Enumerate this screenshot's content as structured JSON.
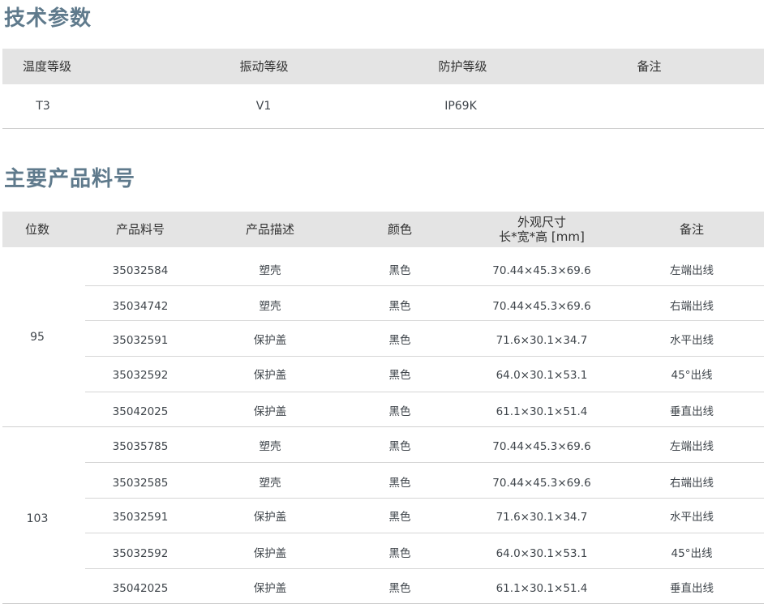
{
  "tech": {
    "title": "技术参数",
    "headers": [
      "温度等级",
      "振动等级",
      "防护等级",
      "备注"
    ],
    "values": [
      "T3",
      "V1",
      "IP69K",
      ""
    ]
  },
  "products": {
    "title": "主要产品料号",
    "headers": {
      "digits": "位数",
      "part_no": "产品料号",
      "desc": "产品描述",
      "color": "颜色",
      "dims_line1": "外观尺寸",
      "dims_line2": "长*宽*高 [mm]",
      "note": "备注"
    },
    "groups": [
      {
        "digits": "95",
        "rows": [
          [
            "35032584",
            "塑壳",
            "黑色",
            "70.44×45.3×69.6",
            "左端出线"
          ],
          [
            "35034742",
            "塑壳",
            "黑色",
            "70.44×45.3×69.6",
            "右端出线"
          ],
          [
            "35032591",
            "保护盖",
            "黑色",
            "71.6×30.1×34.7",
            "水平出线"
          ],
          [
            "35032592",
            "保护盖",
            "黑色",
            "64.0×30.1×53.1",
            "45°出线"
          ],
          [
            "35042025",
            "保护盖",
            "黑色",
            "61.1×30.1×51.4",
            "垂直出线"
          ]
        ]
      },
      {
        "digits": "103",
        "rows": [
          [
            "35035785",
            "塑壳",
            "黑色",
            "70.44×45.3×69.6",
            "左端出线"
          ],
          [
            "35032585",
            "塑壳",
            "黑色",
            "70.44×45.3×69.6",
            "右端出线"
          ],
          [
            "35032591",
            "保护盖",
            "黑色",
            "71.6×30.1×34.7",
            "水平出线"
          ],
          [
            "35032592",
            "保护盖",
            "黑色",
            "64.0×30.1×53.1",
            "45°出线"
          ],
          [
            "35042025",
            "保护盖",
            "黑色",
            "61.1×30.1×51.4",
            "垂直出线"
          ]
        ]
      }
    ]
  }
}
